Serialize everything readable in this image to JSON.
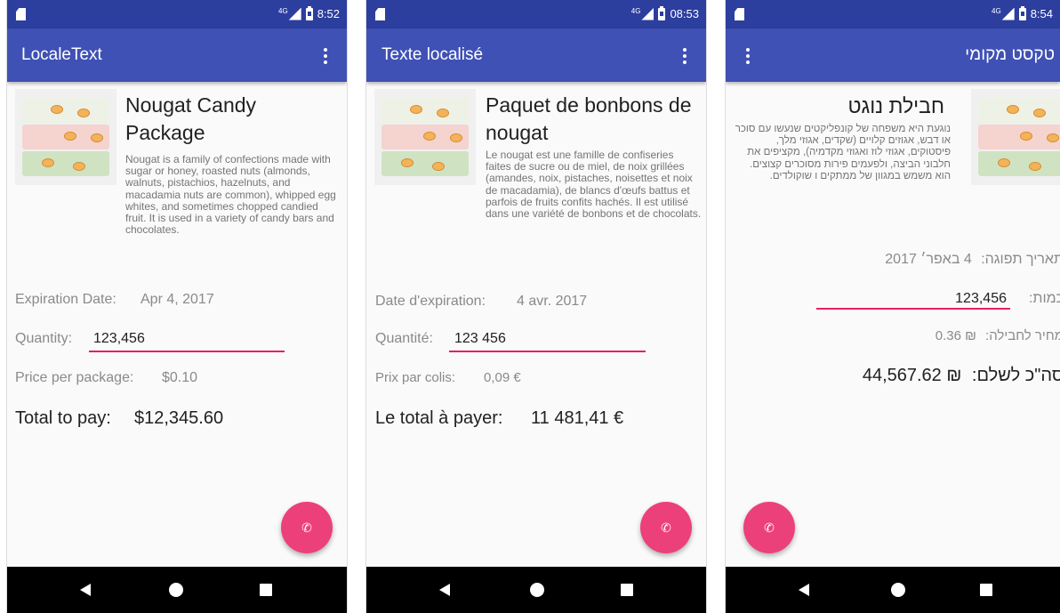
{
  "colors": {
    "primary": "#3f51b5",
    "status_bar": "#2c3e9e",
    "accent": "#e91e63",
    "fab": "#ec407a"
  },
  "screens": [
    {
      "status": {
        "network": "4G",
        "time": "8:52"
      },
      "app_title": "LocaleText",
      "product_title": "Nougat Candy Package",
      "description": "Nougat is a family of confections made with sugar or honey, roasted nuts (almonds, walnuts, pistachios, hazelnuts, and macadamia nuts are common), whipped egg whites, and sometimes chopped candied fruit. It is used in a variety of candy bars and chocolates.",
      "expiration_label": "Expiration Date:",
      "expiration_value": "Apr 4, 2017",
      "quantity_label": "Quantity:",
      "quantity_value": "123,456",
      "price_label": "Price per package:",
      "price_value": "$0.10",
      "total_label": "Total to pay:",
      "total_value": "$12,345.60"
    },
    {
      "status": {
        "network": "4G",
        "time": "08:53"
      },
      "app_title": "Texte localisé",
      "product_title": "Paquet de bonbons de nougat",
      "description": "Le nougat est une famille de confiseries faites de sucre ou de miel, de noix grillées (amandes, noix, pistaches, noisettes et noix de macadamia), de blancs d'œufs battus et parfois de fruits confits hachés. Il est utilisé dans une variété de bonbons et de chocolats.",
      "expiration_label": "Date d'expiration:",
      "expiration_value": "4 avr. 2017",
      "quantity_label": "Quantité:",
      "quantity_value": "123 456",
      "price_label": "Prix par colis:",
      "price_value": "0,09 €",
      "total_label": "Le total à payer:",
      "total_value": "11 481,41 €"
    },
    {
      "status": {
        "network": "4G",
        "time": "8:54"
      },
      "app_title": "טקסט מקומי",
      "product_title": "חבילת נוגט",
      "description": "נוגעת היא משפחה של קונפליקטים שנעשו עם סוכר או דבש, אגוזים קלויים (שקדים, אגוזי מלך, פיסטוקים, אגוזי לוז ואגוזי מקדמיה), מקציפים את חלבוני הביצה, ולפעמים פירות מסוכרים קצוצים. הוא משמש במגוון של ממתקים ו שוקולדים.",
      "expiration_label": "תאריך תפוגה:",
      "expiration_value": "4 באפר׳ 2017",
      "quantity_label": "כמות:",
      "quantity_value": "123,456",
      "price_label": "מחיר לחבילה:",
      "price_value": "₪ 0.36",
      "total_label": "סה\"כ לשלם:",
      "total_value": "₪ 44,567.62"
    }
  ],
  "icons": {
    "fab": "phone-icon",
    "menu": "overflow-menu-icon",
    "nav": [
      "back-icon",
      "home-icon",
      "recents-icon"
    ]
  }
}
